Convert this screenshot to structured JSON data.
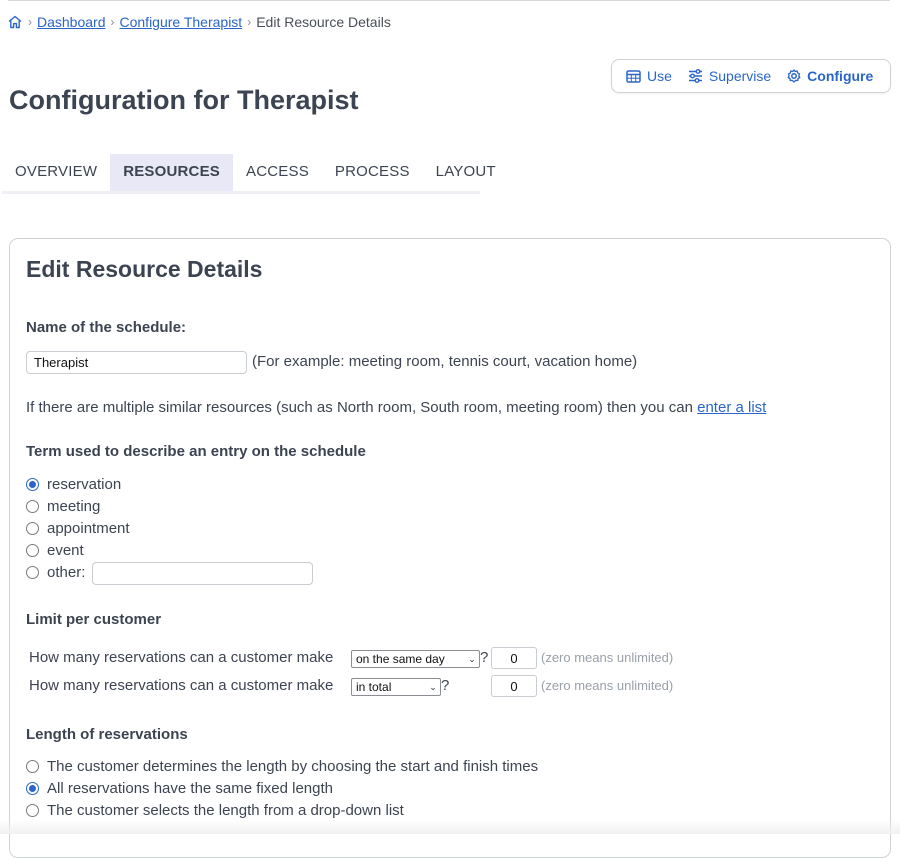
{
  "breadcrumb": {
    "home_icon": "house-icon",
    "items": [
      "Dashboard",
      "Configure Therapist"
    ],
    "current": "Edit Resource Details"
  },
  "modes": {
    "use": "Use",
    "supervise": "Supervise",
    "configure": "Configure",
    "active": "Configure"
  },
  "page_title": "Configuration for Therapist",
  "tabs": [
    {
      "label": "OVERVIEW",
      "active": false
    },
    {
      "label": "RESOURCES",
      "active": true
    },
    {
      "label": "ACCESS",
      "active": false
    },
    {
      "label": "PROCESS",
      "active": false
    },
    {
      "label": "LAYOUT",
      "active": false
    }
  ],
  "form": {
    "title": "Edit Resource Details",
    "name_label": "Name of the schedule:",
    "name_value": "Therapist",
    "name_example": "(For example: meeting room, tennis court, vacation home)",
    "multi_text": "If there are multiple similar resources (such as North room, South room, meeting room) then you can",
    "multi_link": "enter a list",
    "term_label": "Term used to describe an entry on the schedule",
    "term_options": [
      "reservation",
      "meeting",
      "appointment",
      "event",
      "other:"
    ],
    "term_selected": "reservation",
    "other_value": "",
    "limit_label": "Limit per customer",
    "limit_rows": [
      {
        "text": "How many reservations can a customer make",
        "select": "on the same day",
        "suffix": "?",
        "value": "0",
        "hint": "(zero means unlimited)"
      },
      {
        "text": "How many reservations can a customer make",
        "select": "in total",
        "suffix": "?",
        "value": "0",
        "hint": "(zero means unlimited)"
      }
    ],
    "length_label": "Length of reservations",
    "length_options": [
      "The customer determines the length by choosing the start and finish times",
      "All reservations have the same fixed length",
      "The customer selects the length from a drop-down list"
    ],
    "length_selected": "All reservations have the same fixed length"
  },
  "colors": {
    "accent": "#2a66c9",
    "tab_active_bg": "#e9e8f6",
    "text": "#3d4451"
  }
}
